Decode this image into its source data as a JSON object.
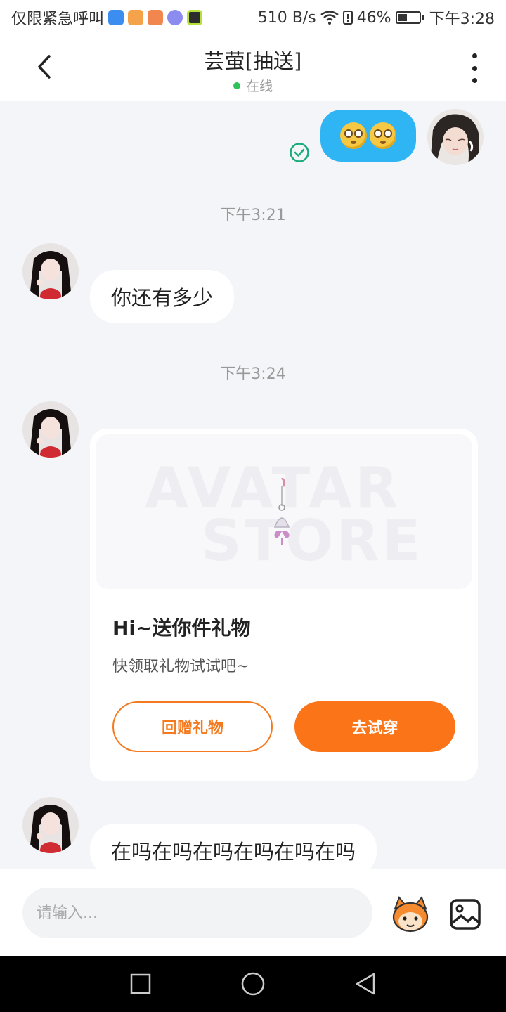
{
  "status_bar": {
    "left_text": "仅限紧急呼叫",
    "speed": "510 B/s",
    "battery_pct": "46%",
    "battery_level": 0.46,
    "time": "下午3:28"
  },
  "header": {
    "title": "芸萤[抽送]",
    "status": "在线"
  },
  "messages": {
    "time_1": "下午3:21",
    "time_2": "下午3:24",
    "text_1": "你还有多少",
    "text_2": "在吗在吗在吗在吗在吗在吗"
  },
  "gift_card": {
    "wm_line1": "AVATAR",
    "wm_line2": "STORE",
    "title": "Hi~送你件礼物",
    "subtitle": "快领取礼物试试吧~",
    "return_gift_label": "回赠礼物",
    "try_on_label": "去试穿"
  },
  "input": {
    "placeholder": "请输入..."
  },
  "colors": {
    "accent_orange": "#fb7417",
    "bubble_blue": "#2fb5f4",
    "online_green": "#2ec25a"
  },
  "icons": [
    "back-icon",
    "more-icon",
    "read-check-icon",
    "emoji-face-icon",
    "image-icon",
    "nav-square-icon",
    "nav-home-icon",
    "nav-back-icon"
  ]
}
